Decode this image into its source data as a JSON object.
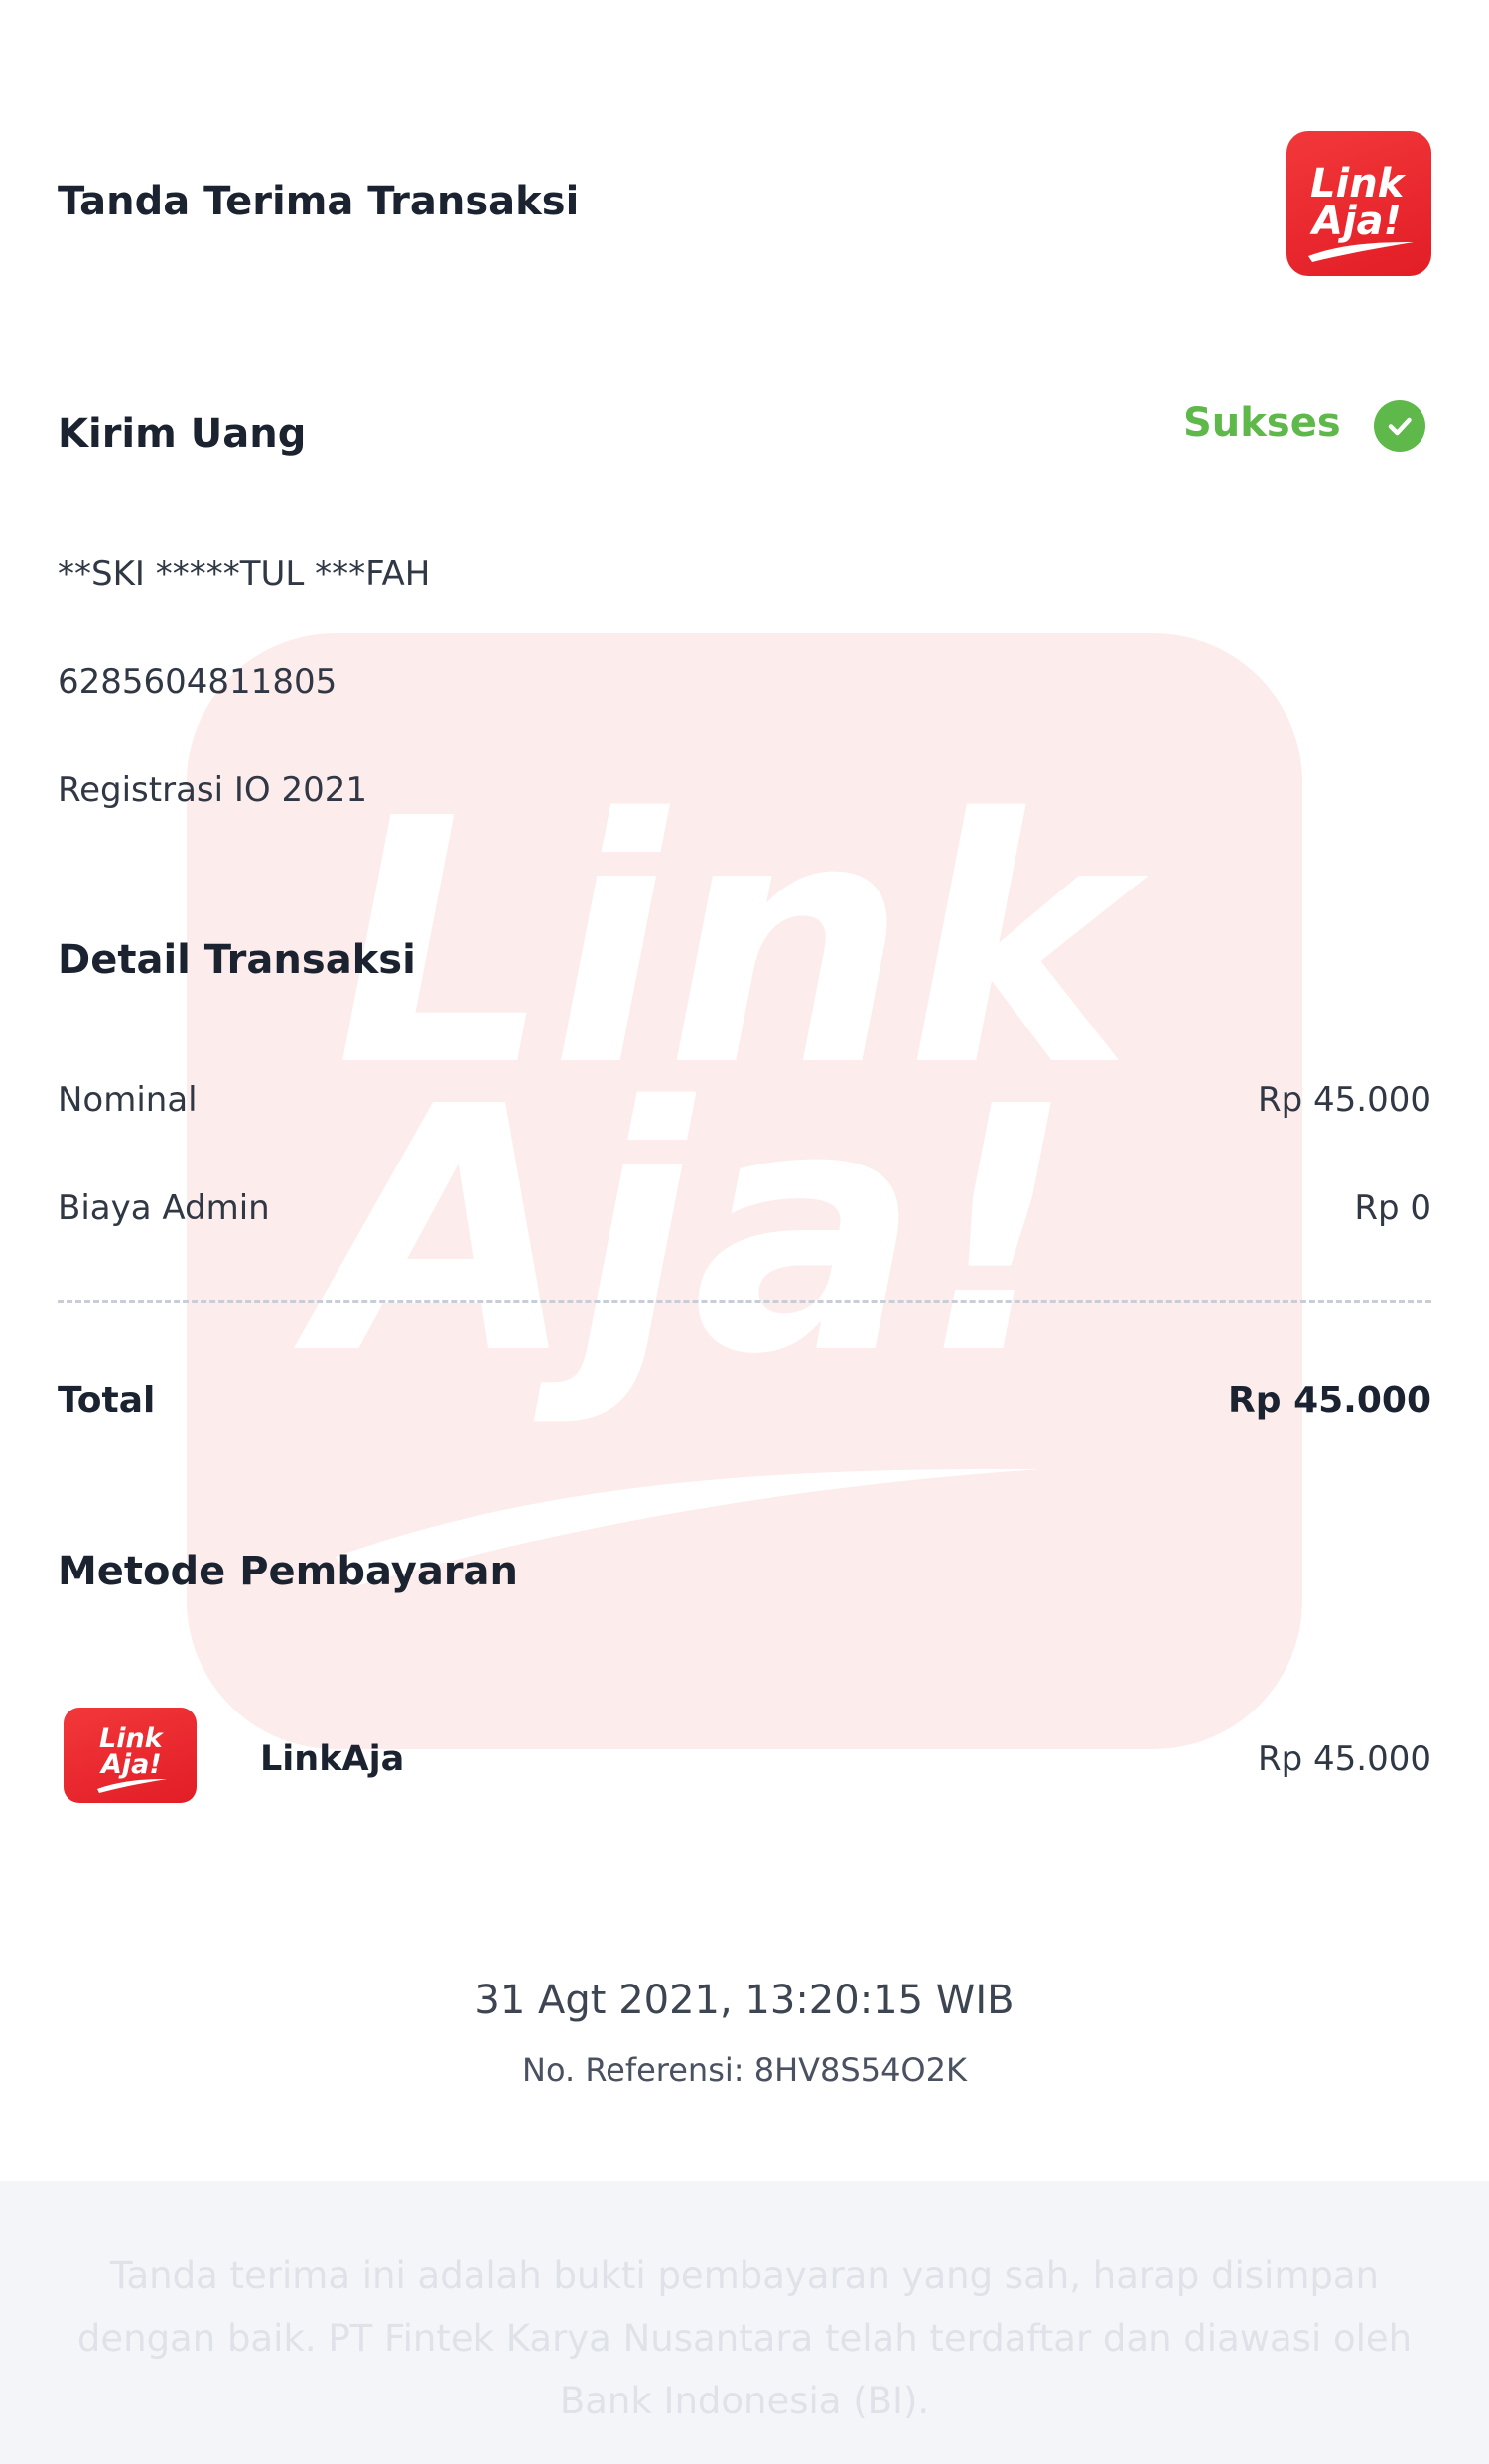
{
  "header": {
    "title": "Tanda Terima Transaksi",
    "logo_text": [
      "Link",
      "Aja!"
    ]
  },
  "transaction": {
    "type": "Kirim Uang",
    "status": "Sukses",
    "status_color": "#5fb94a",
    "recipient_name": "**SKI *****TUL ***FAH",
    "recipient_phone": "6285604811805",
    "note": "Registrasi IO 2021"
  },
  "details": {
    "title": "Detail Transaksi",
    "rows": [
      {
        "label": "Nominal",
        "value": "Rp 45.000"
      },
      {
        "label": "Biaya Admin",
        "value": "Rp 0"
      }
    ],
    "total_label": "Total",
    "total_value": "Rp 45.000"
  },
  "payment": {
    "title": "Metode Pembayaran",
    "method": "LinkAja",
    "amount": "Rp 45.000"
  },
  "meta": {
    "datetime": "31 Agt 2021, 13:20:15 WIB",
    "reference": "No. Referensi: 8HV8S54O2K"
  },
  "footer": {
    "text": "Tanda terima ini adalah bukti pembayaran yang sah, harap disimpan dengan baik. PT Fintek Karya Nusantara telah terdaftar dan diawasi oleh Bank Indonesia (BI)."
  },
  "colors": {
    "brand_red": "#e21d26",
    "watermark": "#fdecec",
    "success": "#5fb94a"
  }
}
